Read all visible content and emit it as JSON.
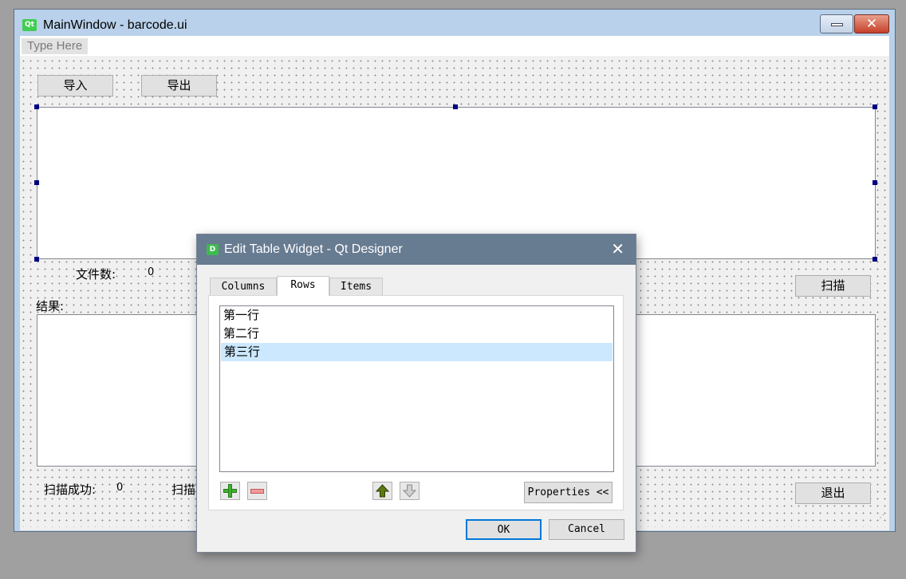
{
  "main_window": {
    "title": "MainWindow - barcode.ui",
    "logo_text": "Qt",
    "menubar": {
      "placeholder": "Type Here"
    },
    "buttons": {
      "import": "导入",
      "export": "导出",
      "scan": "扫描",
      "exit": "退出"
    },
    "labels": {
      "file_count": "文件数:",
      "file_count_value": "0",
      "results": "结果:",
      "scan_success": "扫描成功:",
      "scan_success_value": "0",
      "scan_partial": "扫描"
    }
  },
  "dialog": {
    "title": "Edit Table Widget - Qt Designer",
    "logo_text": "D",
    "tabs": [
      {
        "label": "Columns",
        "active": false
      },
      {
        "label": "Rows",
        "active": true
      },
      {
        "label": "Items",
        "active": false
      }
    ],
    "rows": [
      {
        "label": "第一行",
        "selected": false
      },
      {
        "label": "第二行",
        "selected": false
      },
      {
        "label": "第三行",
        "selected": true
      }
    ],
    "properties_button": "Properties <<",
    "ok_button": "OK",
    "cancel_button": "Cancel"
  },
  "icons": {
    "add": "plus-icon",
    "remove": "minus-icon",
    "move_up": "arrow-up-icon",
    "move_down": "arrow-down-icon",
    "close": "close-icon",
    "minimize": "minimize-icon"
  },
  "colors": {
    "dialog_titlebar": "#677b91",
    "selection": "#cce8ff",
    "default_button_border": "#0078d7",
    "qt_green": "#41cd52"
  }
}
